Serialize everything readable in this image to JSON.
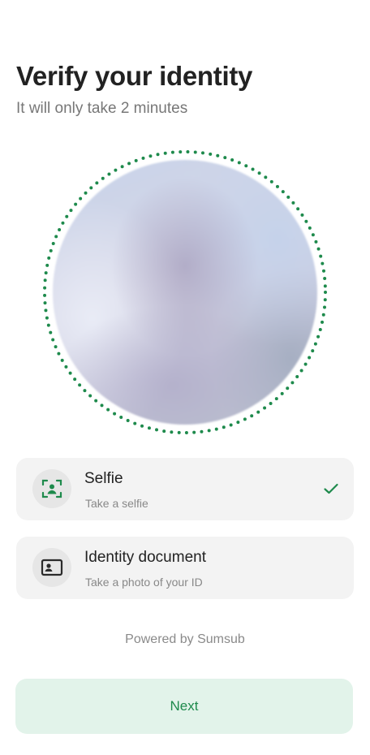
{
  "header": {
    "title": "Verify your identity",
    "subtitle": "It will only take 2 minutes"
  },
  "steps": [
    {
      "title": "Selfie",
      "subtitle": "Take a selfie",
      "icon": "face-scan-icon",
      "completed": true
    },
    {
      "title": "Identity document",
      "subtitle": "Take a photo of your ID",
      "icon": "id-card-icon",
      "completed": false
    }
  ],
  "footer": {
    "powered_by": "Powered by Sumsub",
    "next_label": "Next"
  },
  "colors": {
    "accent": "#1e8a4c",
    "ring_dots": "#1e8a4c",
    "button_bg": "#e2f3ea",
    "card_bg": "#f3f3f3",
    "title": "#222222",
    "subtitle": "#777777"
  }
}
